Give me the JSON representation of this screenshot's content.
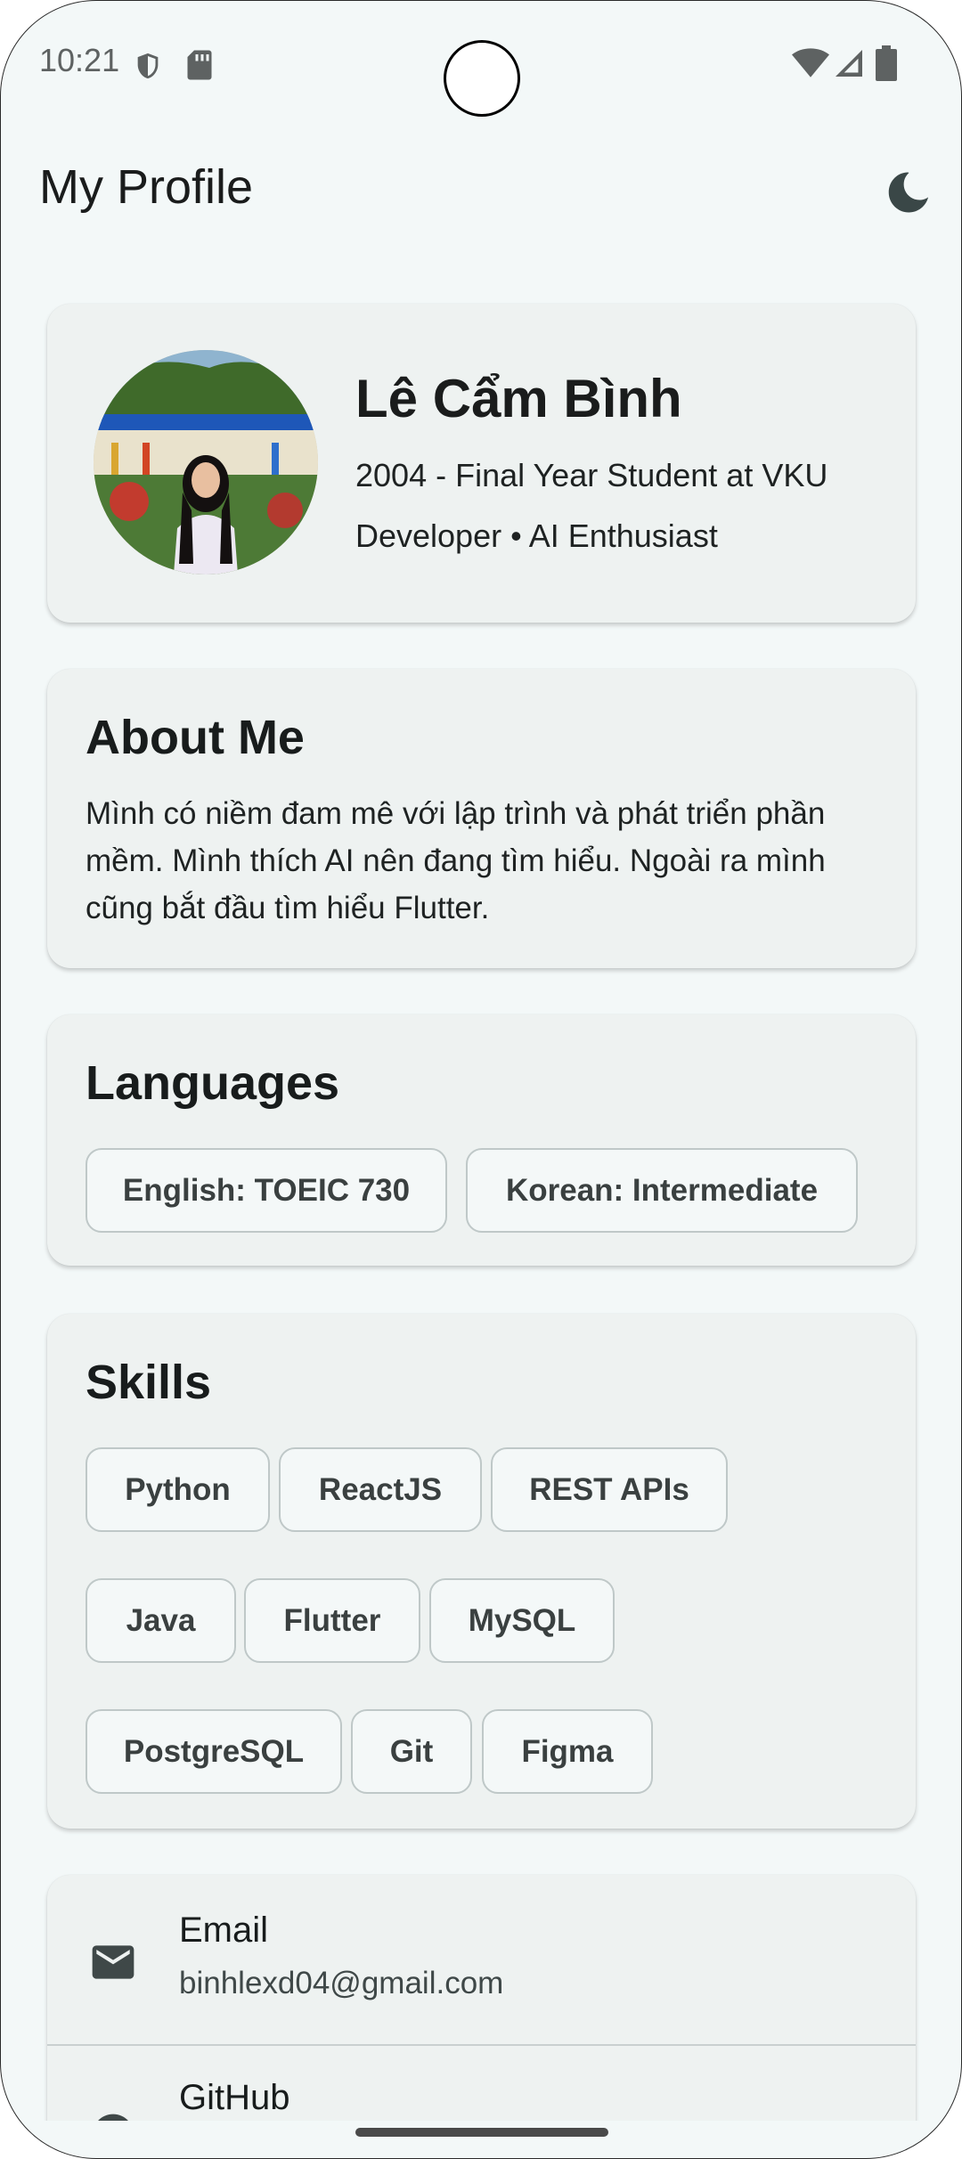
{
  "status_bar": {
    "time": "10:21"
  },
  "app_bar": {
    "title": "My Profile",
    "theme_icon": "moon-icon"
  },
  "profile": {
    "name": "Lê Cẩm Bình",
    "line1": "2004 - Final Year Student at VKU",
    "line2": "Developer • AI Enthusiast"
  },
  "about": {
    "title": "About Me",
    "text": "Mình có niềm đam mê với lập trình và phát triển phần mềm. Mình thích AI nên đang tìm hiểu. Ngoài ra mình cũng bắt đầu tìm hiểu Flutter."
  },
  "languages": {
    "title": "Languages",
    "items": [
      "English: TOEIC 730",
      "Korean: Intermediate"
    ]
  },
  "skills": {
    "title": "Skills",
    "items": [
      "Python",
      "ReactJS",
      "REST APIs",
      "Java",
      "Flutter",
      "MySQL",
      "PostgreSQL",
      "Git",
      "Figma"
    ]
  },
  "contacts": [
    {
      "icon": "mail-icon",
      "label": "Email",
      "value": "binhlexd04@gmail.com"
    },
    {
      "icon": "github-icon",
      "label": "GitHub",
      "value": ""
    }
  ],
  "colors": {
    "background": "#f3f8f8",
    "card": "#eef2f1",
    "chip_border": "#bfc8c8",
    "text": "#1a1c1c"
  }
}
